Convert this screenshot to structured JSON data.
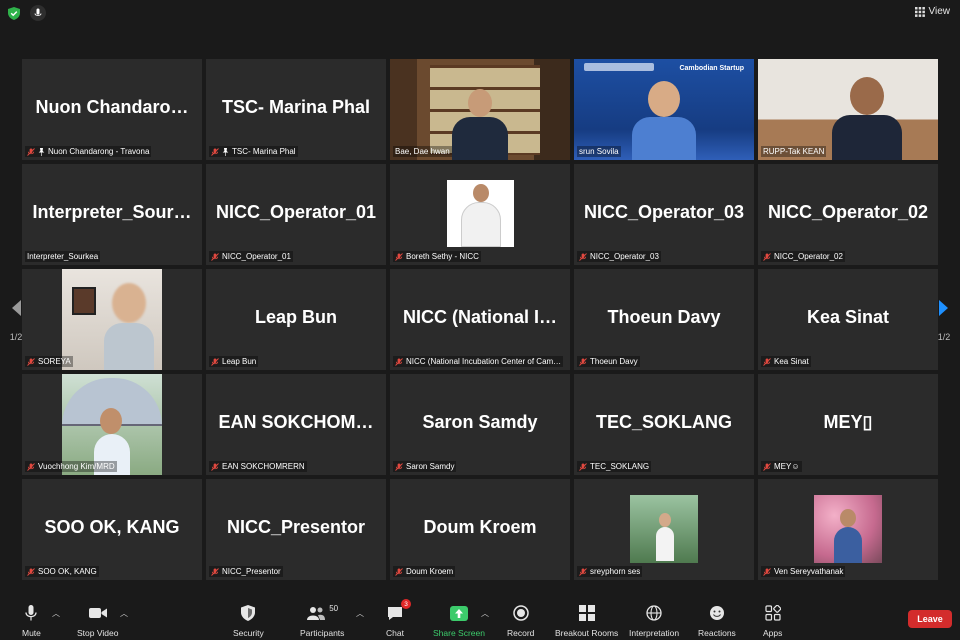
{
  "topbar": {
    "view_label": "View"
  },
  "pages": {
    "left": "1/2",
    "right": "1/2"
  },
  "tiles": [
    {
      "big": "Nuon  Chandaro…",
      "label": "Nuon Chandarong - Travona",
      "pinned": true
    },
    {
      "big": "TSC- Marina Phal",
      "label": "TSC- Marina Phal",
      "pinned": true
    },
    {
      "big": "",
      "label": "Bae, Dae hwan",
      "video": "office"
    },
    {
      "big": "",
      "label": "srun Sovila",
      "video": "slide"
    },
    {
      "big": "",
      "label": "RUPP-Tak KEAN",
      "video": "room"
    },
    {
      "big": "Interpreter_Sour…",
      "label": "Interpreter_Sourkea"
    },
    {
      "big": "NICC_Operator_01",
      "label": "NICC_Operator_01"
    },
    {
      "big": "",
      "label": "Boreth Sethy - NICC",
      "video": "photo-white"
    },
    {
      "big": "NICC_Operator_03",
      "label": "NICC_Operator_03"
    },
    {
      "big": "NICC_Operator_02",
      "label": "NICC_Operator_02"
    },
    {
      "big": "",
      "label": "SOREYA",
      "video": "photo-blur"
    },
    {
      "big": "Leap Bun",
      "label": "Leap Bun"
    },
    {
      "big": "NICC (National I…",
      "label": "NICC (National Incubation Center of Cam…"
    },
    {
      "big": "Thoeun Davy",
      "label": "Thoeun Davy"
    },
    {
      "big": "Kea Sinat",
      "label": "Kea Sinat"
    },
    {
      "big": "",
      "label": "Vuochhong Kim/MRD",
      "video": "photo-umbrella"
    },
    {
      "big": "EAN  SOKCHOM…",
      "label": "EAN SOKCHOMRERN"
    },
    {
      "big": "Saron Samdy",
      "label": "Saron Samdy"
    },
    {
      "big": "TEC_SOKLANG",
      "label": "TEC_SOKLANG"
    },
    {
      "big": "MEY▯",
      "label": "MEY☺"
    },
    {
      "big": "SOO OK, KANG",
      "label": "SOO OK, KANG"
    },
    {
      "big": "NICC_Presentor",
      "label": "NICC_Presentor"
    },
    {
      "big": "Doum Kroem",
      "label": "Doum Kroem"
    },
    {
      "big": "",
      "label": "sreyphorn ses",
      "video": "photo-palm"
    },
    {
      "big": "",
      "label": "Ven Sereyvathanak",
      "video": "photo-flowers"
    }
  ],
  "slide": {
    "brand": "Cambodian Startup"
  },
  "toolbar": {
    "mute": "Mute",
    "stop_video": "Stop Video",
    "security": "Security",
    "participants": "Participants",
    "participants_count": "50",
    "chat": "Chat",
    "chat_badge": "3",
    "share_screen": "Share Screen",
    "record": "Record",
    "breakout": "Breakout Rooms",
    "interpretation": "Interpretation",
    "reactions": "Reactions",
    "apps": "Apps",
    "leave": "Leave"
  },
  "colors": {
    "active_speaker": "#e8e873",
    "leave": "#d32c2c",
    "share": "#3ccb6b",
    "muted": "#e0483f"
  }
}
